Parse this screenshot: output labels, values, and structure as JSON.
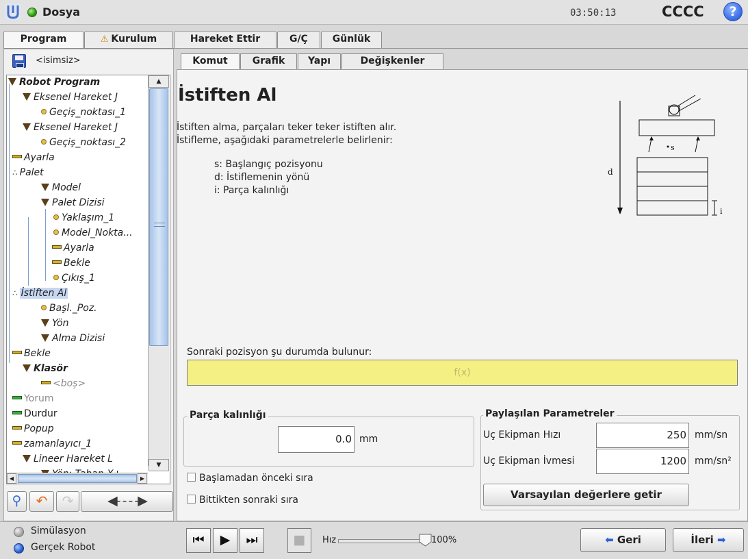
{
  "header": {
    "title": "Dosya",
    "clock": "03:50:13",
    "robot_name": "CCCC",
    "help": "?"
  },
  "main_tabs": [
    "Program",
    "Kurulum",
    "Hareket Ettir",
    "G/Ç",
    "Günlük"
  ],
  "left": {
    "program_name": "<isimsiz>",
    "tree": [
      "Robot Program",
      "Eksenel Hareket J",
      "Geçiş_noktası_1",
      "Eksenel Hareket J",
      "Geçiş_noktası_2",
      "Ayarla",
      "Palet",
      "Model",
      "Palet Dizisi",
      "Yaklaşım_1",
      "Model_Nokta...",
      "Ayarla",
      "Bekle",
      "Çıkış_1",
      "İstiften Al",
      "Başl._Poz.",
      "Yön",
      "Alma Dizisi",
      "Bekle",
      "Klasör",
      "<boş>",
      "Yorum",
      "Durdur",
      "Popup",
      "zamanlayıcı_1",
      "Lineer Hareket L",
      "Yön: Taban X+"
    ]
  },
  "sub_tabs": [
    "Komut",
    "Grafik",
    "Yapı",
    "Değişkenler"
  ],
  "command": {
    "title": "İstiften Al",
    "desc_line1": "İstiften alma, parçaları teker teker istiften alır.",
    "desc_line2": "İstifleme, aşağıdaki parametrelerle belirlenir:",
    "param_s": "s: Başlangıç pozisyonu",
    "param_d": "d: İstiflemenin yönü",
    "param_i": "i: Parça kalınlığı",
    "diagram": {
      "label_d": "d",
      "label_s": "s",
      "label_i": "i"
    },
    "next_pos_label": "Sonraki pozisyon şu durumda bulunur:",
    "fx_placeholder": "f(x)",
    "thickness_title": "Parça kalınlığı",
    "thickness_value": "0.0",
    "thickness_unit": "mm",
    "start_seq_label": "Başlamadan önceki sıra",
    "end_seq_label": "Bittikten sonraki sıra"
  },
  "shared": {
    "title": "Paylaşılan Parametreler",
    "speed_label": "Uç Ekipman Hızı",
    "speed_value": "250",
    "speed_unit": "mm/sn",
    "accel_label": "Uç Ekipman İvmesi",
    "accel_value": "1200",
    "accel_unit": "mm/sn²",
    "defaults_button": "Varsayılan değerlere getir"
  },
  "footer": {
    "simulation_label": "Simülasyon",
    "real_robot_label": "Gerçek Robot",
    "speed_label": "Hız",
    "speed_value": "100%",
    "speed_fraction": 1.0,
    "back_label": "Geri",
    "next_label": "İleri"
  },
  "colors": {
    "fx_field": "#f5f083",
    "selection": "#c6d7f2",
    "accent_blue": "#2d62d4"
  }
}
